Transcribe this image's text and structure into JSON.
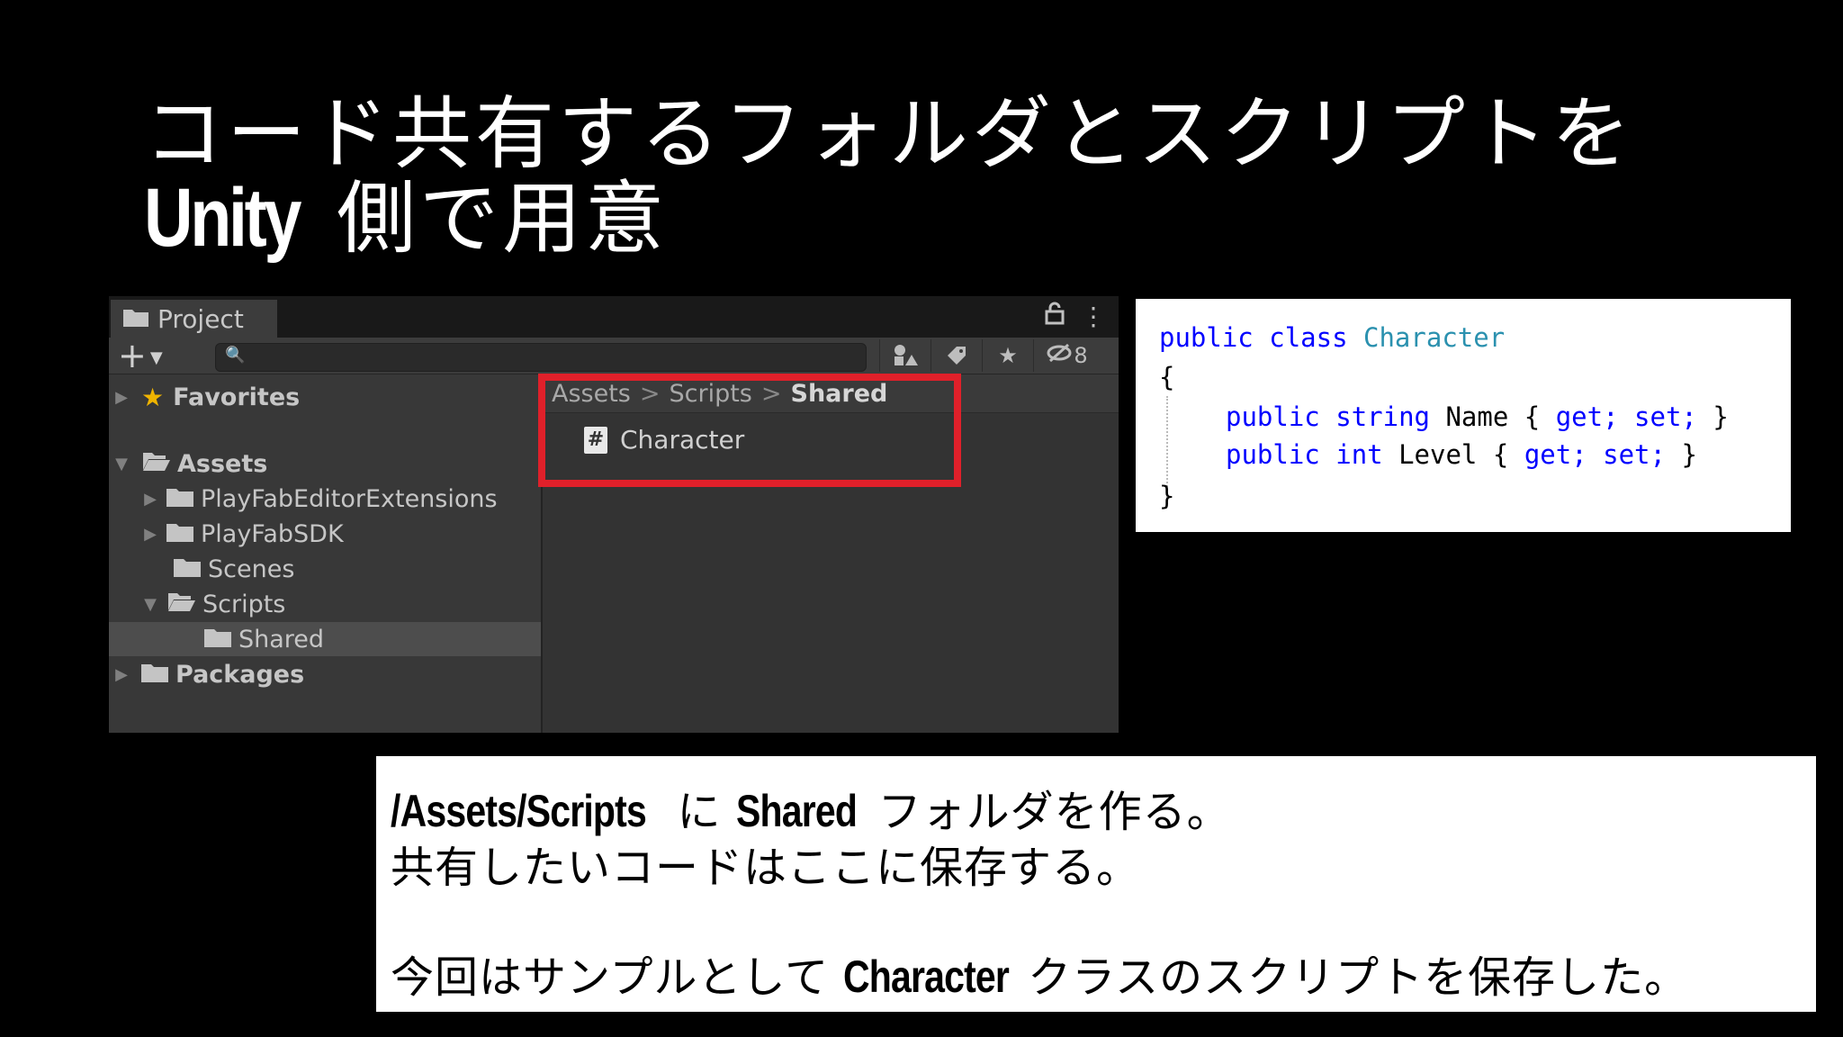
{
  "slide": {
    "title_line1": "コード共有するフォルダとスクリプトを",
    "title_line2_bold": "Unity",
    "title_line2_rest": "側で用意"
  },
  "project_window": {
    "tab_label": "Project",
    "hidden_count": "8",
    "tree": {
      "favorites": "Favorites",
      "assets": "Assets",
      "playfab_editor_ext": "PlayFabEditorExtensions",
      "playfab_sdk": "PlayFabSDK",
      "scenes": "Scenes",
      "scripts": "Scripts",
      "shared": "Shared",
      "packages": "Packages"
    },
    "breadcrumb": [
      "Assets",
      "Scripts",
      "Shared"
    ],
    "breadcrumb_sep": ">",
    "file_name": "Character",
    "file_icon": "#"
  },
  "code": {
    "l1_kw1": "public",
    "l1_kw2": "class",
    "l1_type": "Character",
    "l2": "{",
    "l3_kw1": "public",
    "l3_kw2": "string",
    "l3_name": "Name",
    "l3_ob": "{",
    "l3_get": "get;",
    "l3_set": "set;",
    "l3_cb": "}",
    "l4_kw1": "public",
    "l4_kw2": "int",
    "l4_name": "Level",
    "l4_ob": "{",
    "l4_get": "get;",
    "l4_set": "set;",
    "l4_cb": "}",
    "l5": "}"
  },
  "description": {
    "line1_bold1": "/Assets/Scripts",
    "line1_t1": "に",
    "line1_bold2": "Shared",
    "line1_t2": "フォルダを作る。",
    "line2": "共有したいコードはここに保存する。",
    "line3_t1": "今回はサンプルとして",
    "line3_bold": "Character",
    "line3_t2": "クラスのスクリプトを保存した。"
  },
  "colors": {
    "highlight_box": "#e0202a",
    "code_keyword": "#0000ff",
    "code_type": "#2b91af"
  }
}
